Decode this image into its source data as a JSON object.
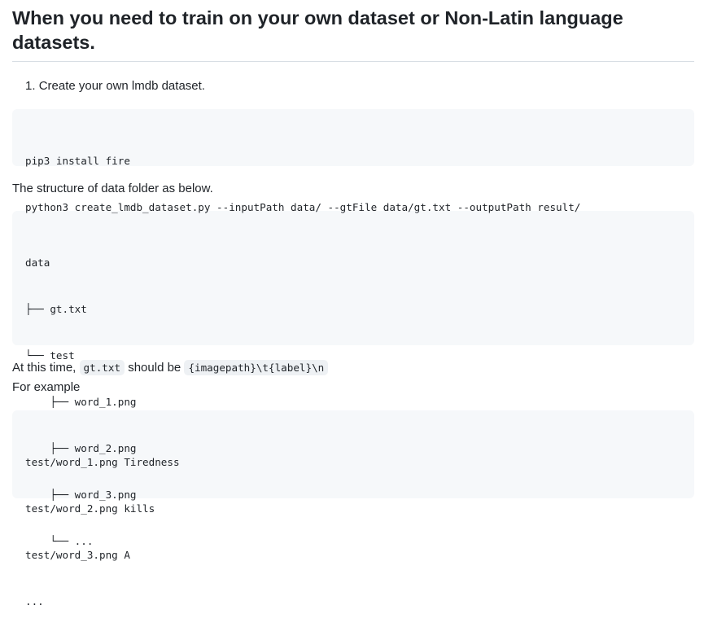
{
  "heading": "When you need to train on your own dataset or Non-Latin language datasets.",
  "steps": [
    {
      "number": "1.",
      "text": "Create your own lmdb dataset."
    }
  ],
  "code_install": [
    "pip3 install fire",
    "python3 create_lmdb_dataset.py --inputPath data/ --gtFile data/gt.txt --outputPath result/"
  ],
  "para_structure": "The structure of data folder as below.",
  "code_tree": [
    "data",
    "├── gt.txt",
    "└── test",
    "    ├── word_1.png",
    "    ├── word_2.png",
    "    ├── word_3.png",
    "    └── ..."
  ],
  "para_format": {
    "prefix": "At this time,",
    "code_file": "gt.txt",
    "middle": "should be",
    "code_format": "{imagepath}\\t{label}\\n"
  },
  "para_example": "For example",
  "code_example": [
    "test/word_1.png Tiredness",
    "test/word_2.png kills",
    "test/word_3.png A",
    "..."
  ]
}
